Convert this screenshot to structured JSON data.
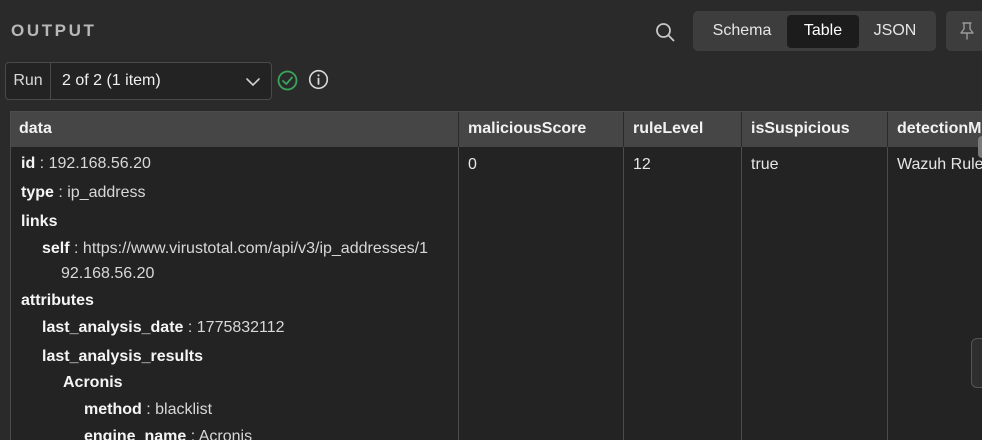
{
  "panel": {
    "title": "OUTPUT"
  },
  "view_tabs": [
    {
      "label": "Schema",
      "active": false
    },
    {
      "label": "Table",
      "active": true
    },
    {
      "label": "JSON",
      "active": false
    }
  ],
  "run": {
    "label": "Run",
    "value": "2 of 2 (1 item)"
  },
  "table": {
    "columns": [
      "data",
      "maliciousScore",
      "ruleLevel",
      "isSuspicious",
      "detectionM"
    ],
    "row": {
      "maliciousScore": "0",
      "ruleLevel": "12",
      "isSuspicious": "true",
      "detectionM": "Wazuh Rule"
    },
    "data_tree": {
      "id": {
        "key": "id",
        "value": "192.168.56.20"
      },
      "type": {
        "key": "type",
        "value": "ip_address"
      },
      "links": {
        "key": "links"
      },
      "self": {
        "key": "self",
        "value_line1": "https://www.virustotal.com/api/v3/ip_addresses/1",
        "value_line2": "92.168.56.20"
      },
      "attributes": {
        "key": "attributes"
      },
      "last_analysis_date": {
        "key": "last_analysis_date",
        "value": "1775832112"
      },
      "last_analysis_results": {
        "key": "last_analysis_results"
      },
      "acronis": {
        "key": "Acronis"
      },
      "method": {
        "key": "method",
        "value": "blacklist"
      },
      "engine_name": {
        "key": "engine_name",
        "value": "Acronis"
      }
    }
  },
  "colors": {
    "success": "#3ba55d",
    "active_tab_bg": "#1c1c1c",
    "header_bg": "#464646"
  }
}
